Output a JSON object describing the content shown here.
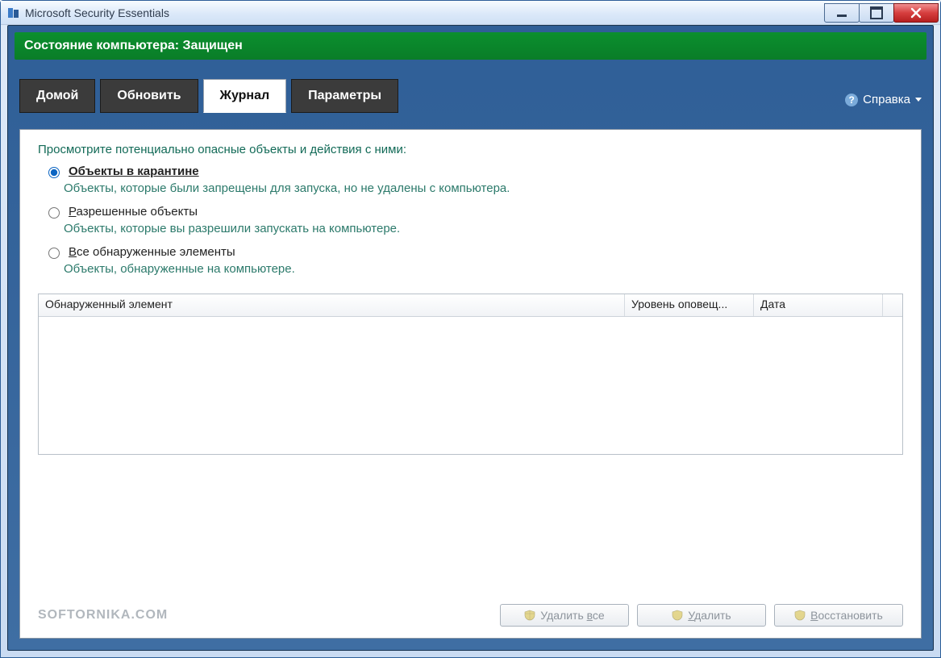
{
  "window": {
    "title": "Microsoft Security Essentials"
  },
  "status": {
    "text": "Состояние компьютера: Защищен"
  },
  "tabs": {
    "home": {
      "label": "Домой"
    },
    "update": {
      "label": "Обновить"
    },
    "history": {
      "label": "Журнал"
    },
    "settings": {
      "label": "Параметры"
    }
  },
  "help": {
    "label": "Справка"
  },
  "content": {
    "intro": "Просмотрите потенциально опасные объекты и действия с ними:",
    "options": {
      "quarantine": {
        "label_prefix": "О",
        "label_rest": "бъекты в карантине",
        "desc": "Объекты, которые были запрещены для запуска, но не удалены с компьютера."
      },
      "allowed": {
        "label_prefix": "Р",
        "label_rest": "азрешенные объекты",
        "desc": "Объекты, которые вы разрешили запускать на компьютере."
      },
      "all": {
        "label_prefix": "В",
        "label_rest": "се обнаруженные элементы",
        "desc": "Объекты, обнаруженные на компьютере."
      }
    }
  },
  "table": {
    "col_item": "Обнаруженный элемент",
    "col_level": "Уровень оповещ...",
    "col_date": "Дата"
  },
  "footer": {
    "watermark": "SOFTORNIKA.COM",
    "delete_all_pre": "Удалить ",
    "delete_all_u": "в",
    "delete_all_post": "се",
    "delete_u": "У",
    "delete_post": "далить",
    "restore_u": "В",
    "restore_post": "осстановить"
  }
}
